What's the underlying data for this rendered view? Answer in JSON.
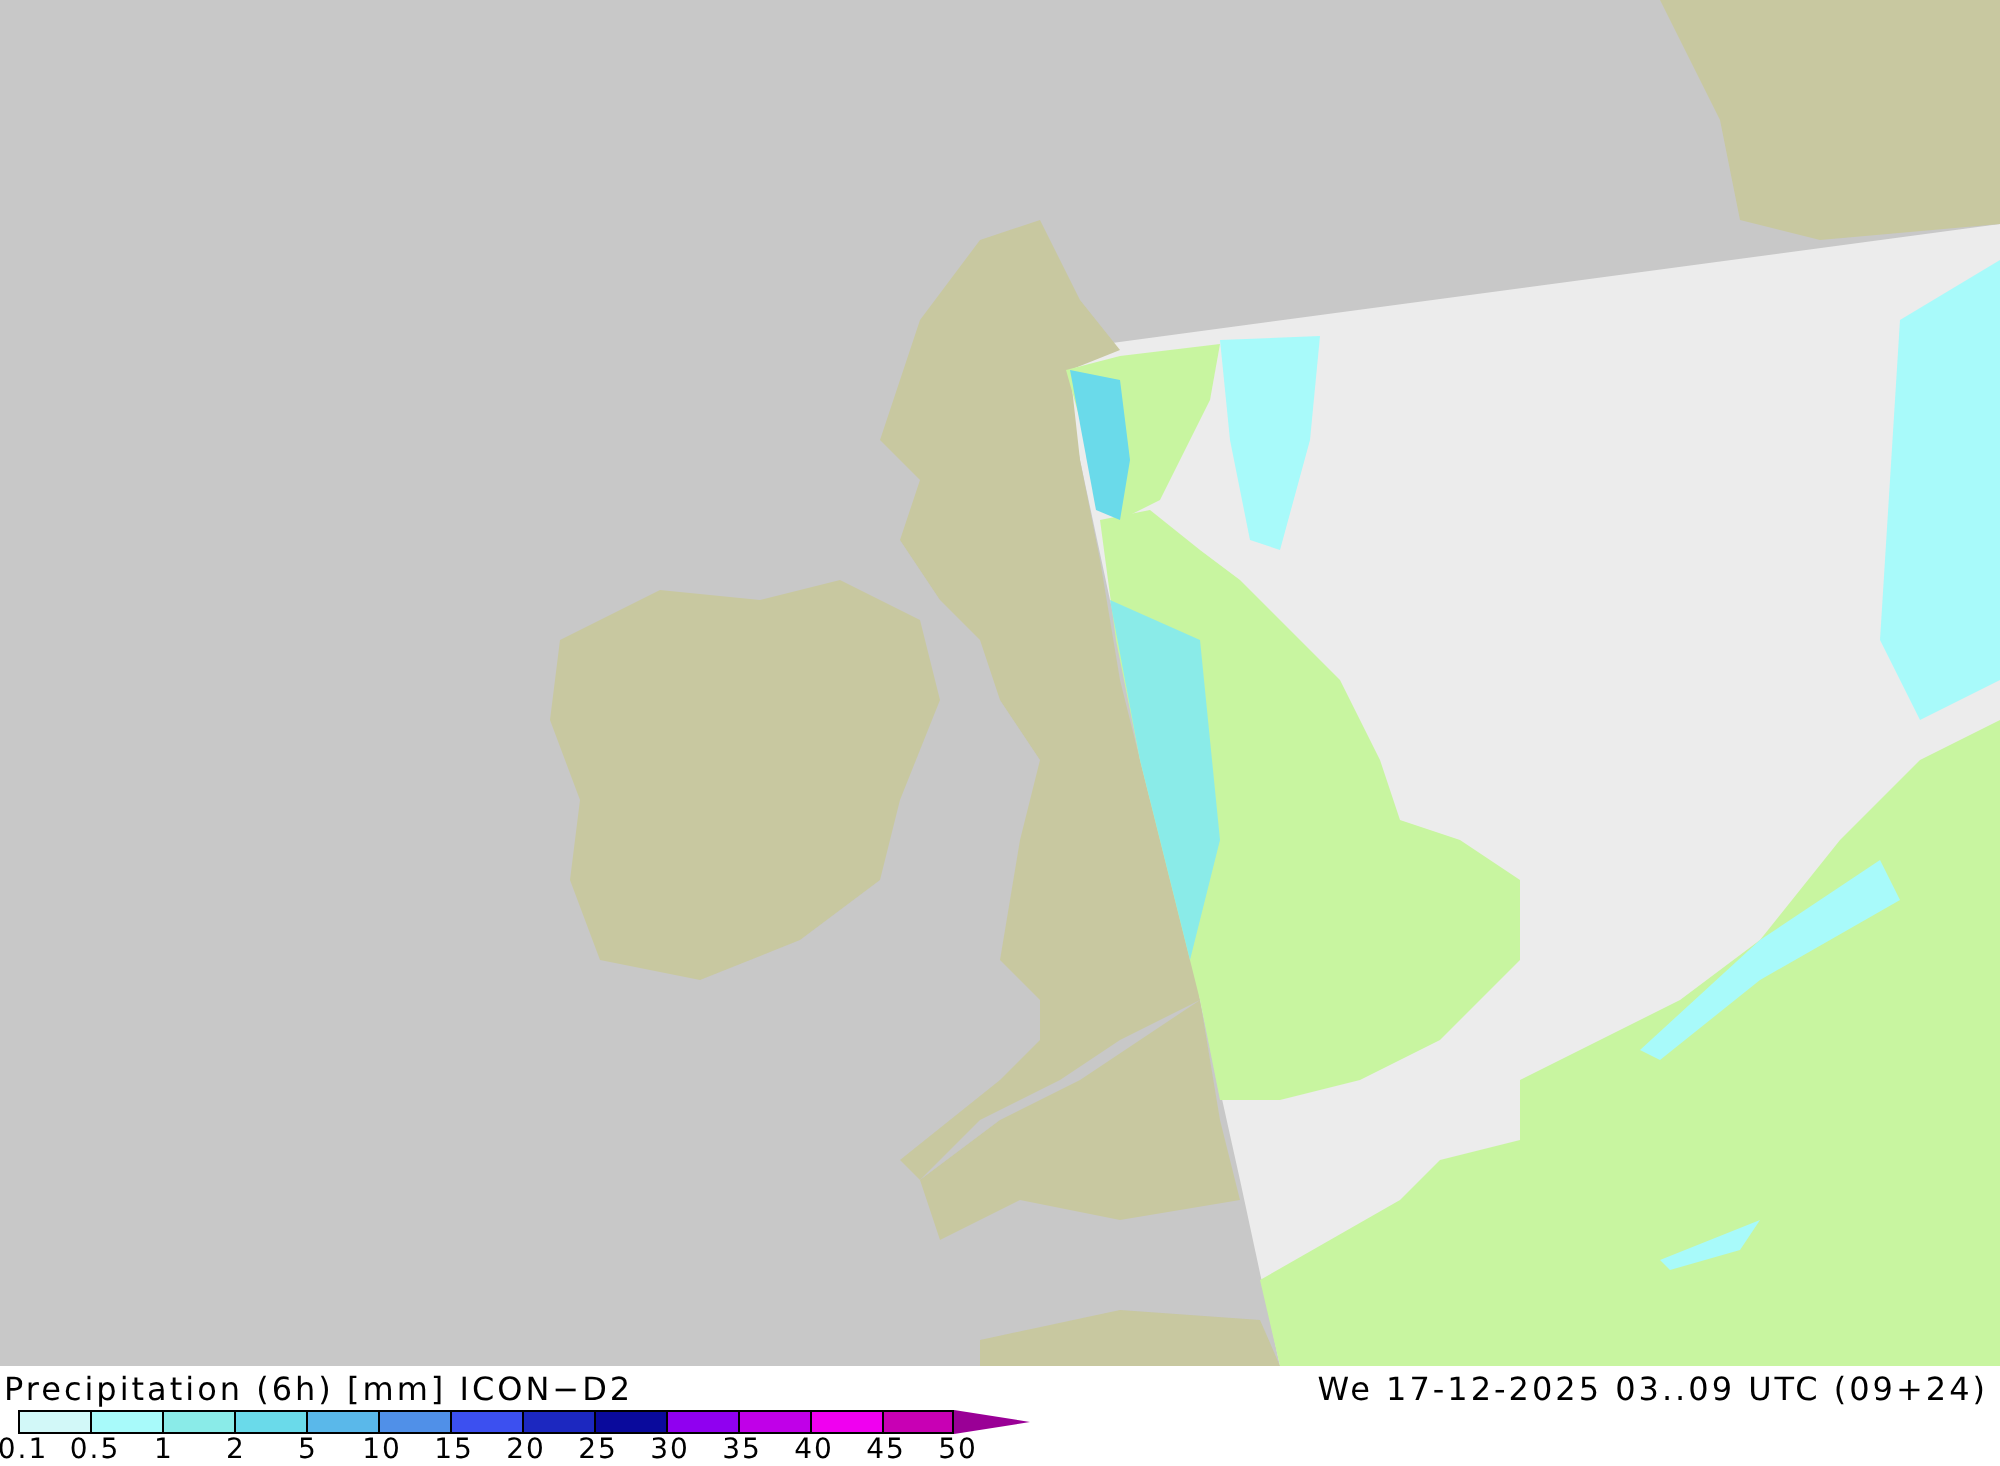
{
  "title": "Precipitation (6h) [mm] ICON−D2",
  "valid_time": "We 17-12-2025 03..09 UTC (09+24)",
  "legend": {
    "bins": [
      {
        "color": "#d2f8f8"
      },
      {
        "color": "#a8fafa"
      },
      {
        "color": "#8aebe8"
      },
      {
        "color": "#6adaea"
      },
      {
        "color": "#5ab8ea"
      },
      {
        "color": "#5090e8"
      },
      {
        "color": "#3c50f0"
      },
      {
        "color": "#1c28c0"
      },
      {
        "color": "#0a0a9c"
      },
      {
        "color": "#9000f0"
      },
      {
        "color": "#c000e8"
      },
      {
        "color": "#f000f0"
      },
      {
        "color": "#c800b4"
      }
    ],
    "labels": [
      "0.1",
      "0.5",
      "1",
      "2",
      "5",
      "10",
      "15",
      "20",
      "25",
      "30",
      "35",
      "40",
      "45",
      "50"
    ]
  }
}
